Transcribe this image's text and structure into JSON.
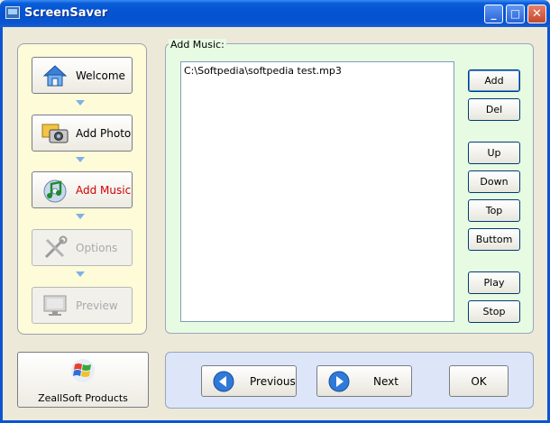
{
  "window": {
    "title": "ScreenSaver",
    "controls": {
      "minimize": "_",
      "maximize": "□",
      "close": "✕"
    }
  },
  "nav": {
    "items": [
      {
        "label": "Welcome",
        "icon": "house-icon",
        "state": "normal"
      },
      {
        "label": "Add Photo",
        "icon": "camera-icon",
        "state": "normal"
      },
      {
        "label": "Add Music",
        "icon": "music-cd-icon",
        "state": "active"
      },
      {
        "label": "Options",
        "icon": "tools-icon",
        "state": "disabled"
      },
      {
        "label": "Preview",
        "icon": "monitor-icon",
        "state": "disabled"
      }
    ]
  },
  "music": {
    "legend": "Add Music:",
    "files": [
      "C:\\Softpedia\\softpedia test.mp3"
    ],
    "buttons": {
      "add": "Add",
      "del": "Del",
      "up": "Up",
      "down": "Down",
      "top": "Top",
      "bottom": "Buttom",
      "play": "Play",
      "stop": "Stop"
    }
  },
  "products": {
    "label": "ZeallSoft Products",
    "icon": "windows-logo-icon"
  },
  "footer": {
    "previous": "Previous",
    "next": "Next",
    "ok": "OK"
  },
  "colors": {
    "accent": "#0b55d3",
    "active_label": "#d40000",
    "nav_panel_bg": "#fdfbd8",
    "group_bg": "#e6fbe2",
    "bottom_bg": "#dde6f8"
  }
}
